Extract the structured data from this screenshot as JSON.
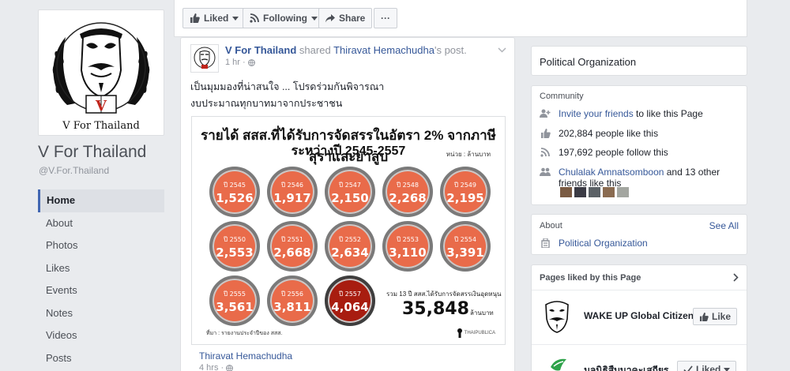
{
  "page": {
    "name": "V For Thailand",
    "handle": "@V.For.Thailand",
    "logo_text": "V For Thailand"
  },
  "nav": [
    "Home",
    "About",
    "Photos",
    "Likes",
    "Events",
    "Notes",
    "Videos",
    "Posts"
  ],
  "actions": {
    "liked": "Liked",
    "following": "Following",
    "share": "Share",
    "more": "···"
  },
  "post": {
    "author": "V For Thailand",
    "shared_word": "shared",
    "original_author": "Thiravat Hemachudha",
    "original_suffix": "'s post.",
    "time": "1 hr · ",
    "line1": "เป็นมุมมองที่น่าสนใจ ... โปรดร่วมกันพิจารณา",
    "line2": "งบประมาณทุกบาทมาจากประชาชน",
    "shared_author": "Thiravat Hemachudha",
    "shared_time": "4 hrs · "
  },
  "infographic": {
    "title_line1": "รายได้ สสส.ที่ได้รับการจัดสรรในอัตรา 2% จากภาษีสุราและยาสูบ",
    "title_line2": "ระหว่างปี 2545-2557",
    "unit": "หน่วย : ล้านบาท",
    "items": [
      {
        "year": "ปี 2545",
        "value": "1,526"
      },
      {
        "year": "ปี 2546",
        "value": "1,917"
      },
      {
        "year": "ปี 2547",
        "value": "2,150"
      },
      {
        "year": "ปี 2548",
        "value": "2,268"
      },
      {
        "year": "ปี 2549",
        "value": "2,195"
      },
      {
        "year": "ปี 2550",
        "value": "2,553"
      },
      {
        "year": "ปี 2551",
        "value": "2,668"
      },
      {
        "year": "ปี 2552",
        "value": "2,634"
      },
      {
        "year": "ปี 2553",
        "value": "3,110"
      },
      {
        "year": "ปี 2554",
        "value": "3,391"
      },
      {
        "year": "ปี 2555",
        "value": "3,561"
      },
      {
        "year": "ปี 2556",
        "value": "3,811"
      },
      {
        "year": "ปี 2557",
        "value": "4,064"
      }
    ],
    "total_label": "รวม 13 ปี สสส.ได้รับการจัดสรรเงินอุดหนุน",
    "total_value": "35,848",
    "total_unit": "ล้านบาท",
    "source": "ที่มา : รายงานประจำปีของ สสส.",
    "logo": "THAIPUBLICA",
    "colors": {
      "circle": "#e96b4a",
      "highlight": "#a81d10"
    }
  },
  "sidebar": {
    "category": "Political Organization",
    "community": {
      "title": "Community",
      "invite_link": "Invite your friends",
      "invite_rest": " to like this Page",
      "likes": "202,884 people like this",
      "follows": "197,692 people follow this",
      "friend_name": "Chulalak Amnatsomboon",
      "friend_rest": " and 13 other friends like this"
    },
    "about": {
      "title": "About",
      "see_all": "See All",
      "category": "Political Organization"
    },
    "pages_liked": {
      "title": "Pages liked by this Page",
      "page1_name": "WAKE UP Global Citizen",
      "page1_btn": "Like",
      "page2_name": "มูลนิธิสืบนาคะเสถียร",
      "page2_btn": "Liked"
    }
  }
}
